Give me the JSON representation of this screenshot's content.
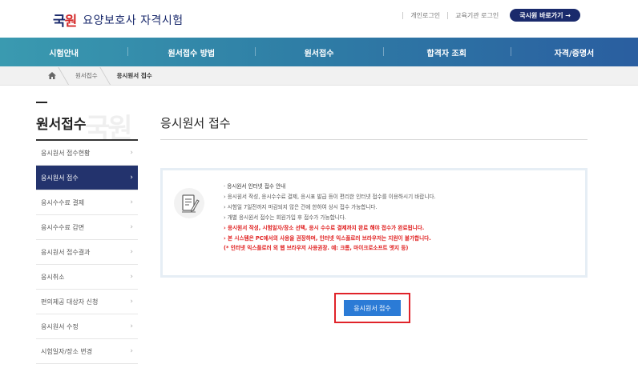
{
  "header": {
    "logo_mark_1": "국",
    "logo_mark_2": "원",
    "site_title": "요양보호사 자격시험",
    "links": [
      "개인로그인",
      "교육기관 로그인"
    ],
    "go_button": "국시원 바로가기 →"
  },
  "nav": {
    "items": [
      "시험안내",
      "원서접수 방법",
      "원서접수",
      "합격자 조회",
      "자격/증명서"
    ]
  },
  "breadcrumb": {
    "items": [
      "원서접수",
      "응시원서 접수"
    ]
  },
  "sidebar": {
    "title": "원서접수",
    "watermark": "국원",
    "items": [
      {
        "label": "응시원서 접수현황",
        "active": false
      },
      {
        "label": "응시원서 접수",
        "active": true
      },
      {
        "label": "응시수수료 결제",
        "active": false
      },
      {
        "label": "응시수수료 감면",
        "active": false
      },
      {
        "label": "응시원서 접수결과",
        "active": false
      },
      {
        "label": "응시취소",
        "active": false
      },
      {
        "label": "편의제공 대상자 신청",
        "active": false
      },
      {
        "label": "응시원서 수정",
        "active": false
      },
      {
        "label": "시험일자/장소 변경",
        "active": false
      }
    ]
  },
  "main": {
    "title": "응시원서 접수",
    "notice": {
      "heading": "· 응시원서 인터넷 접수 안내",
      "lines": [
        "› 응시원서 작성, 응시수수료 결제, 응시표 발급 등이 편리한 인터넷 접수를 이용하시기 바랍니다.",
        "› 시험일 7일전까지 마감되지 않은 건에 한하여 상시 접수 가능합니다.",
        "› 개별 응시원서 접수는 회원가입 후 접수가 가능합니다."
      ],
      "red_lines": [
        "› 응시원서 작성, 시험일자/장소 선택, 응시 수수료 결제까지 완료 해야 접수가 완료됩니다.",
        "› 본 시스템은 PC에서의 사용을 권장하며, 인터넷 익스플로러 브라우저는 지원이 불가합니다.",
        "(* 인터넷 익스플로러 외 웹 브라우저 사용권장. 예: 크롬, 마이크로소프트 엣지 등)"
      ]
    },
    "apply_button": "응시원서 접수"
  },
  "colors": {
    "brand_navy": "#1a2a6c",
    "nav_start": "#3a9ab0",
    "nav_end": "#2a5ea0",
    "active_side": "#23336d",
    "button_blue": "#2b7bd6",
    "highlight_red": "#e0232a",
    "warning_red": "#e02020"
  }
}
